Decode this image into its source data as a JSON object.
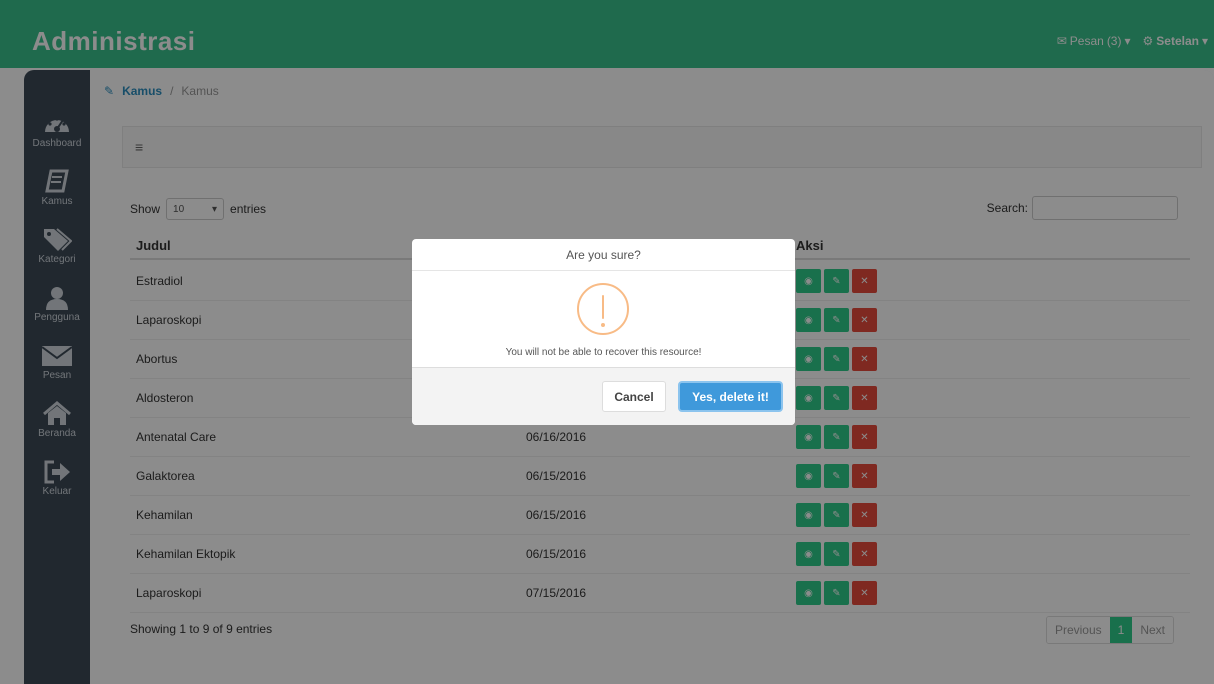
{
  "header": {
    "brand": "Administrasi",
    "messages_label": "Pesan",
    "messages_count": "(3)",
    "settings_label": "Setelan"
  },
  "sidebar": {
    "items": [
      {
        "label": "Dashboard",
        "icon": "dashboard-icon"
      },
      {
        "label": "Kamus",
        "icon": "book-icon"
      },
      {
        "label": "Kategori",
        "icon": "tags-icon"
      },
      {
        "label": "Pengguna",
        "icon": "user-icon"
      },
      {
        "label": "Pesan",
        "icon": "envelope-icon"
      },
      {
        "label": "Beranda",
        "icon": "home-icon"
      },
      {
        "label": "Keluar",
        "icon": "sign-out-icon"
      }
    ]
  },
  "breadcrumb": {
    "main": "Kamus",
    "sub": "Kamus"
  },
  "table": {
    "show_label": "Show",
    "length_value": "10",
    "entries_label": "entries",
    "search_label": "Search:",
    "search_value": "",
    "headers": [
      "Judul",
      "Aksi"
    ],
    "rows": [
      {
        "judul": "Estradiol",
        "date": ""
      },
      {
        "judul": "Laparoskopi",
        "date": ""
      },
      {
        "judul": "Abortus",
        "date": ""
      },
      {
        "judul": "Aldosteron",
        "date": ""
      },
      {
        "judul": "Antenatal Care",
        "date": "06/16/2016"
      },
      {
        "judul": "Galaktorea",
        "date": "06/15/2016"
      },
      {
        "judul": "Kehamilan",
        "date": "06/15/2016"
      },
      {
        "judul": "Kehamilan Ektopik",
        "date": "06/15/2016"
      },
      {
        "judul": "Laparoskopi",
        "date": "07/15/2016"
      }
    ],
    "info": "Showing 1 to 9 of 9 entries",
    "pager": {
      "previous": "Previous",
      "current": "1",
      "next": "Next"
    }
  },
  "modal": {
    "title": "Are you sure?",
    "text": "You will not be able to recover this resource!",
    "cancel": "Cancel",
    "confirm": "Yes, delete it!"
  },
  "colors": {
    "accent": "#39c28c",
    "sidebar": "#3d4a57",
    "confirm": "#3f99db",
    "danger": "#e74c3c",
    "warning": "#f8bb86"
  }
}
